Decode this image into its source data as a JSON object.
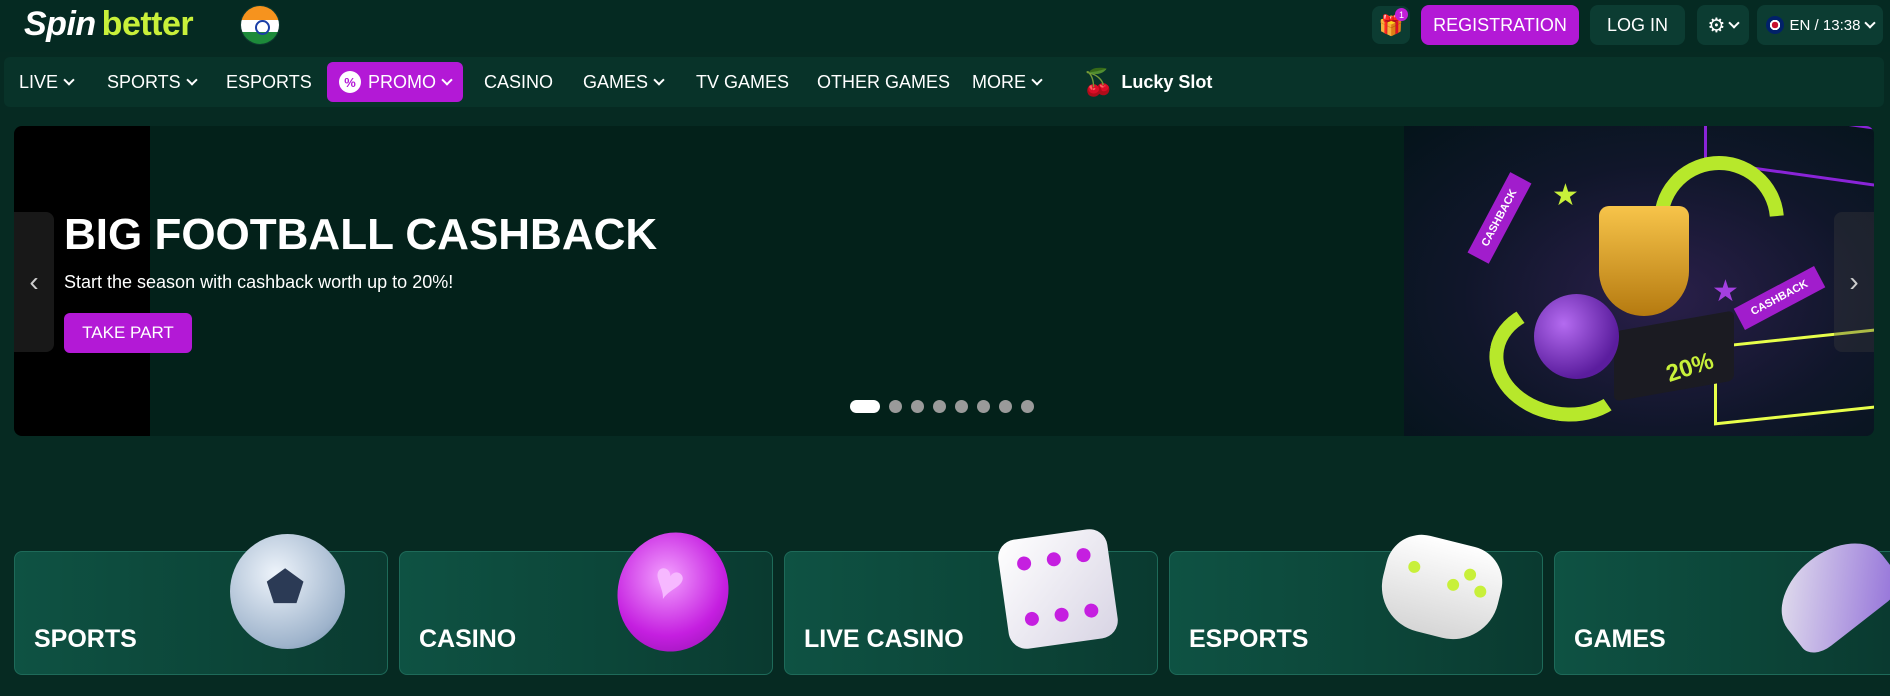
{
  "header": {
    "logo_part1": "Spin",
    "logo_part2": "better",
    "flag": "india-flag",
    "gift_count": "1",
    "registration_label": "REGISTRATION",
    "login_label": "LOG IN",
    "language": "EN / 13:38"
  },
  "nav": {
    "items": [
      {
        "label": "LIVE",
        "has_dropdown": true
      },
      {
        "label": "SPORTS",
        "has_dropdown": true
      },
      {
        "label": "ESPORTS",
        "has_dropdown": false
      },
      {
        "label": "PROMO",
        "has_dropdown": true,
        "highlight": true
      },
      {
        "label": "CASINO",
        "has_dropdown": false
      },
      {
        "label": "GAMES",
        "has_dropdown": true
      },
      {
        "label": "TV GAMES",
        "has_dropdown": false
      },
      {
        "label": "OTHER GAMES",
        "has_dropdown": false
      },
      {
        "label": "MORE",
        "has_dropdown": true
      },
      {
        "label": "Lucky Slot",
        "has_dropdown": false,
        "icon": "cherry-icon"
      }
    ]
  },
  "banner": {
    "title": "BIG FOOTBALL CASHBACK",
    "subtitle": "Start the season with cashback worth up to 20%!",
    "button_label": "TAKE PART",
    "art_ribbon_1": "CASHBACK",
    "art_ribbon_2": "CASHBACK",
    "art_badge": "20%",
    "slide_count": 8,
    "active_slide": 1,
    "prev_arrow": "‹",
    "next_arrow": "›"
  },
  "categories": [
    {
      "label": "SPORTS",
      "icon": "soccer-ball-icon"
    },
    {
      "label": "CASINO",
      "icon": "casino-chip-icon"
    },
    {
      "label": "LIVE CASINO",
      "icon": "dice-icon"
    },
    {
      "label": "ESPORTS",
      "icon": "gamepad-icon"
    },
    {
      "label": "GAMES",
      "icon": "rocket-icon"
    }
  ],
  "colors": {
    "background": "#062a22",
    "accent_purple": "#b319d6",
    "accent_lime": "#c8f03a"
  }
}
